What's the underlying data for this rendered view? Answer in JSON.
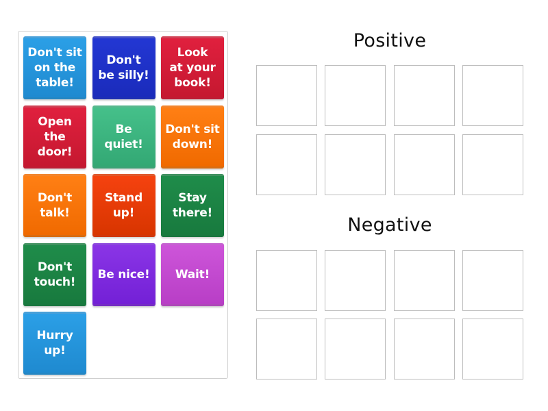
{
  "activity": {
    "type": "group-sort",
    "source_tiles": [
      {
        "label": "Don't sit\non the\ntable!",
        "color": "#2b9fe6",
        "color_dark": "#1f8ad0"
      },
      {
        "label": "Don't\nbe silly!",
        "color": "#2337d3",
        "color_dark": "#1a2bbb"
      },
      {
        "label": "Look\nat your\nbook!",
        "color": "#e0203e",
        "color_dark": "#c51830"
      },
      {
        "label": "Open\nthe\ndoor!",
        "color": "#e0203e",
        "color_dark": "#c51830"
      },
      {
        "label": "Be\nquiet!",
        "color": "#45c08a",
        "color_dark": "#33a874"
      },
      {
        "label": "Don't sit\ndown!",
        "color": "#ff7f14",
        "color_dark": "#f06a00"
      },
      {
        "label": "Don't\ntalk!",
        "color": "#ff7f14",
        "color_dark": "#f06a00"
      },
      {
        "label": "Stand\nup!",
        "color": "#f5420f",
        "color_dark": "#d83500"
      },
      {
        "label": "Stay\nthere!",
        "color": "#1f8c4a",
        "color_dark": "#187a3e"
      },
      {
        "label": "Don't\ntouch!",
        "color": "#1f8c4a",
        "color_dark": "#187a3e"
      },
      {
        "label": "Be nice!",
        "color": "#8a35e6",
        "color_dark": "#7320d6"
      },
      {
        "label": "Wait!",
        "color": "#cd55d9",
        "color_dark": "#b83ec6"
      },
      {
        "label": "Hurry\nup!",
        "color": "#2b9fe6",
        "color_dark": "#1f8ad0"
      }
    ],
    "groups": [
      {
        "title": "Positive",
        "slot_count": 8
      },
      {
        "title": "Negative",
        "slot_count": 8
      }
    ]
  }
}
